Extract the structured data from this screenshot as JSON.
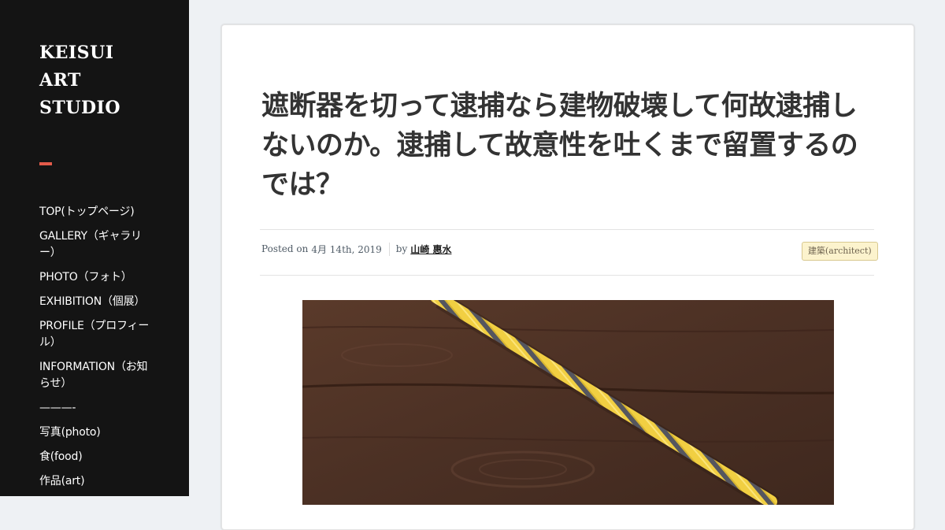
{
  "site": {
    "title_lines": [
      "KEISUI",
      "ART",
      "STUDIO"
    ]
  },
  "nav": {
    "items": [
      "TOP(トップページ)",
      "GALLERY（ギャラリー）",
      "PHOTO（フォト）",
      "EXHIBITION（個展）",
      "PROFILE（プロフィール）",
      "INFORMATION（お知らせ）",
      "———-",
      "写真(photo)",
      "食(food)",
      "作品(art)"
    ]
  },
  "post": {
    "title": "遮断器を切って逮捕なら建物破壊して何故逮捕しないのか。逮捕して故意性を吐くまで留置するのでは？",
    "posted_on_label": "Posted on",
    "date": "4月 14th, 2019",
    "by_label": "by",
    "author": "山崎 惠水",
    "category": "建築(architect)",
    "image_description": "yellow and gray twisted rope on dark wood"
  },
  "colors": {
    "sidebar_bg": "#141414",
    "page_bg": "#eef1f4",
    "accent": "#e35b4a",
    "tag_bg": "#fcf3cd"
  }
}
